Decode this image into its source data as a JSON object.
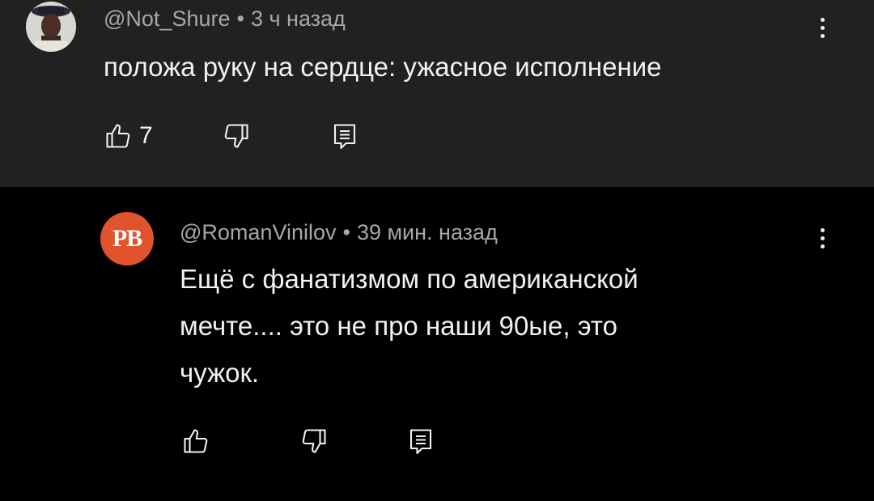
{
  "comments": [
    {
      "avatar": "user-photo",
      "author": "@Not_Shure",
      "time": "3 ч назад",
      "text_lines": [
        "положа руку на сердце: ужасное исполнение"
      ],
      "likes": "7",
      "icons": {
        "like": "thumbs-up-icon",
        "dislike": "thumbs-down-icon",
        "reply": "reply-icon",
        "menu": "more-vert-icon"
      }
    },
    {
      "avatar_initials": "PB",
      "avatar_color": "#e0532c",
      "author": "@RomanVinilov",
      "time": "39 мин. назад",
      "text_lines": [
        "Ещё с фанатизмом по американской",
        "мечте.... это не про наши 90ые, это",
        "чужок."
      ],
      "likes": "",
      "icons": {
        "like": "thumbs-up-icon",
        "dislike": "thumbs-down-icon",
        "reply": "reply-icon",
        "menu": "more-vert-icon"
      }
    }
  ],
  "separator": "•",
  "colors": {
    "top_bg": "#212121",
    "reply_bg": "#000000",
    "text": "#f1f1f1",
    "meta": "#a7a7a7"
  }
}
